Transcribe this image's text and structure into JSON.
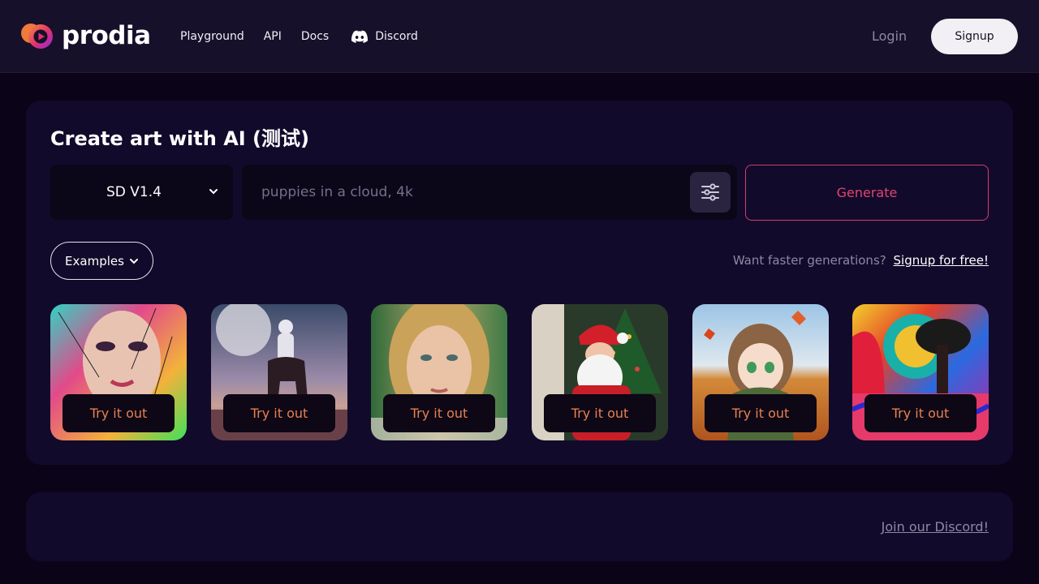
{
  "brand": {
    "name": "prodia"
  },
  "nav": {
    "items": [
      {
        "label": "Playground"
      },
      {
        "label": "API"
      },
      {
        "label": "Docs"
      },
      {
        "label": "Discord",
        "icon": "discord-icon"
      }
    ]
  },
  "auth": {
    "login_label": "Login",
    "signup_label": "Signup"
  },
  "create": {
    "title": "Create art with AI (测试)",
    "model": {
      "selected": "SD V1.4"
    },
    "prompt": {
      "placeholder": "puppies in a cloud, 4k",
      "value": ""
    },
    "settings_icon": "sliders-icon",
    "generate_label": "Generate",
    "examples_label": "Examples",
    "faster_text": "Want faster generations?",
    "faster_link": "Signup for free!"
  },
  "gallery": {
    "items": [
      {
        "subject": "colorful-portrait",
        "button": "Try it out"
      },
      {
        "subject": "astronaut-on-horse",
        "button": "Try it out"
      },
      {
        "subject": "woman-portrait",
        "button": "Try it out"
      },
      {
        "subject": "santa-claus",
        "button": "Try it out"
      },
      {
        "subject": "anime-girl-autumn",
        "button": "Try it out"
      },
      {
        "subject": "psychedelic-tree",
        "button": "Try it out"
      }
    ]
  },
  "footer": {
    "discord_link": "Join our Discord!"
  },
  "colors": {
    "background": "#0b0418",
    "header": "#17102a",
    "card": "#120a2b",
    "accent": "#e0456f",
    "try_text": "#e8804f"
  }
}
